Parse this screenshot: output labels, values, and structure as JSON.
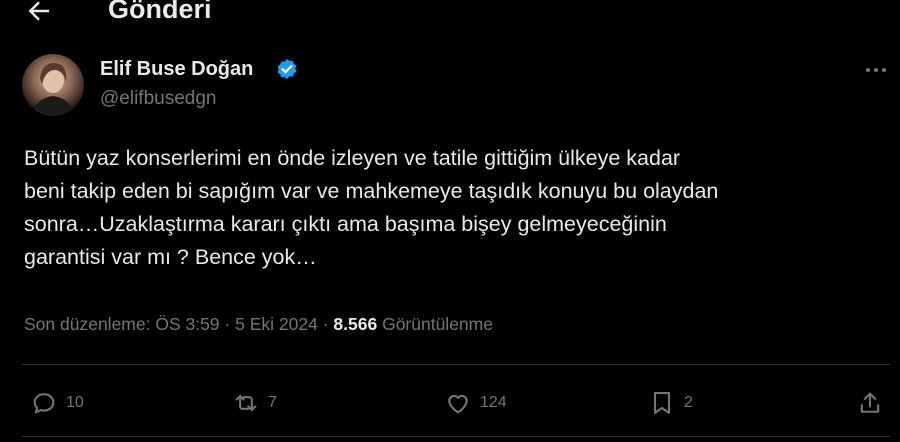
{
  "header": {
    "title": "Gönderi"
  },
  "author": {
    "name": "Elif Buse Doğan",
    "handle": "@elifbusedgn"
  },
  "tweet": {
    "text": "Bütün yaz konserlerimi en önde izleyen ve tatile gittiğim ülkeye kadar\nbeni takip eden bi sapığım var ve mahkemeye taşıdık konuyu bu olaydan\nsonra…Uzaklaştırma kararı çıktı ama başıma bişey gelmeyeceğinin\ngarantisi var mı ? Bence yok…"
  },
  "meta": {
    "edited_label": "Son düzenleme: ÖS 3:59",
    "separator": "·",
    "date": "5 Eki 2024",
    "views_count": "8.566",
    "views_label": "Görüntülenme"
  },
  "actions": {
    "replies": "10",
    "reposts": "7",
    "likes": "124",
    "bookmarks": "2"
  },
  "colors": {
    "background": "#000000",
    "text": "#e7e9ea",
    "muted": "#71767b",
    "verified": "#1d9bf0"
  }
}
